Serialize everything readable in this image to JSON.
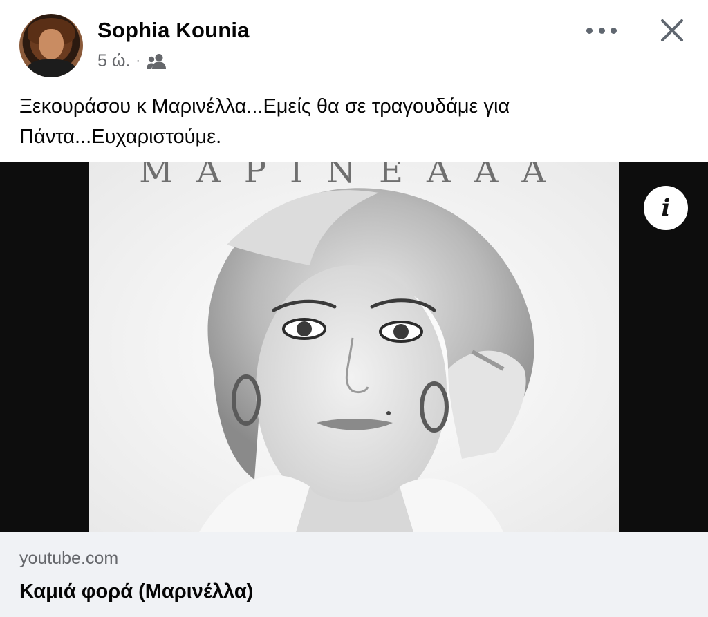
{
  "post": {
    "author": "Sophia Kounia",
    "time": "5 ώ.",
    "separator": "·",
    "audience_icon": "friends-icon",
    "text": "Ξεκουράσου κ Μαρινέλλα...Εμείς θα σε τραγουδάμε για Πάντα...Ευχαριστούμε."
  },
  "header": {
    "more_icon": "more-dots-icon",
    "close_icon": "close-icon"
  },
  "link": {
    "banner_text": "MAPINEAAA",
    "info_icon": "i",
    "domain": "youtube.com",
    "title": "Καμιά φορά (Μαρινέλλα)"
  },
  "colors": {
    "text_primary": "#050505",
    "text_secondary": "#65676b",
    "footer_bg": "#f0f2f5",
    "preview_bg": "#0d0d0d"
  }
}
